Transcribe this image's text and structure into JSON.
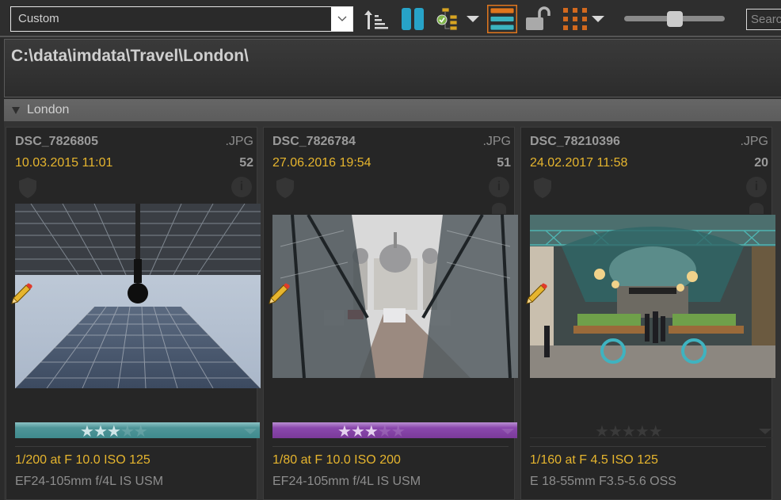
{
  "toolbar": {
    "preset": "Custom",
    "icons": [
      "sort-ascending-icon",
      "columns-icon",
      "workflow-check-icon",
      "dropdown-arrow-icon",
      "list-view-icon",
      "unlock-icon",
      "grid-view-icon",
      "dropdown-arrow-icon"
    ],
    "thumbnail_size": 0.5,
    "search_placeholder": "Search"
  },
  "path": "C:\\data\\imdata\\Travel\\London\\",
  "group": {
    "name": "London"
  },
  "colors": {
    "accent_date": "#e6b52e",
    "label_teal": "#3f8a8d",
    "label_purple": "#7b3a9a"
  },
  "cards": [
    {
      "filename": "DSC_7826805",
      "ext": ".JPG",
      "date": "10.03.2015 11:01",
      "number": "52",
      "rating": 3,
      "max_rating": 5,
      "label_color": "teal",
      "exposure": "1/200 at F 10.0 ISO 125",
      "lens": "EF24-105mm f/4L IS USM",
      "photo_subject": "skyscraper looking up"
    },
    {
      "filename": "DSC_7826784",
      "ext": ".JPG",
      "date": "27.06.2016 19:54",
      "number": "51",
      "rating": 3,
      "max_rating": 5,
      "label_color": "purple",
      "exposure": "1/80 at F 10.0 ISO 200",
      "lens": "EF24-105mm f/4L IS USM",
      "photo_subject": "St Paul's Cathedral through glass"
    },
    {
      "filename": "DSC_78210396",
      "ext": ".JPG",
      "date": "24.02.2017 11:58",
      "number": "20",
      "rating": 0,
      "max_rating": 5,
      "label_color": "none",
      "exposure": "1/160 at F 4.5 ISO 125",
      "lens": "E 18-55mm F3.5-5.6 OSS",
      "photo_subject": "Covent Garden Apple Market"
    }
  ]
}
